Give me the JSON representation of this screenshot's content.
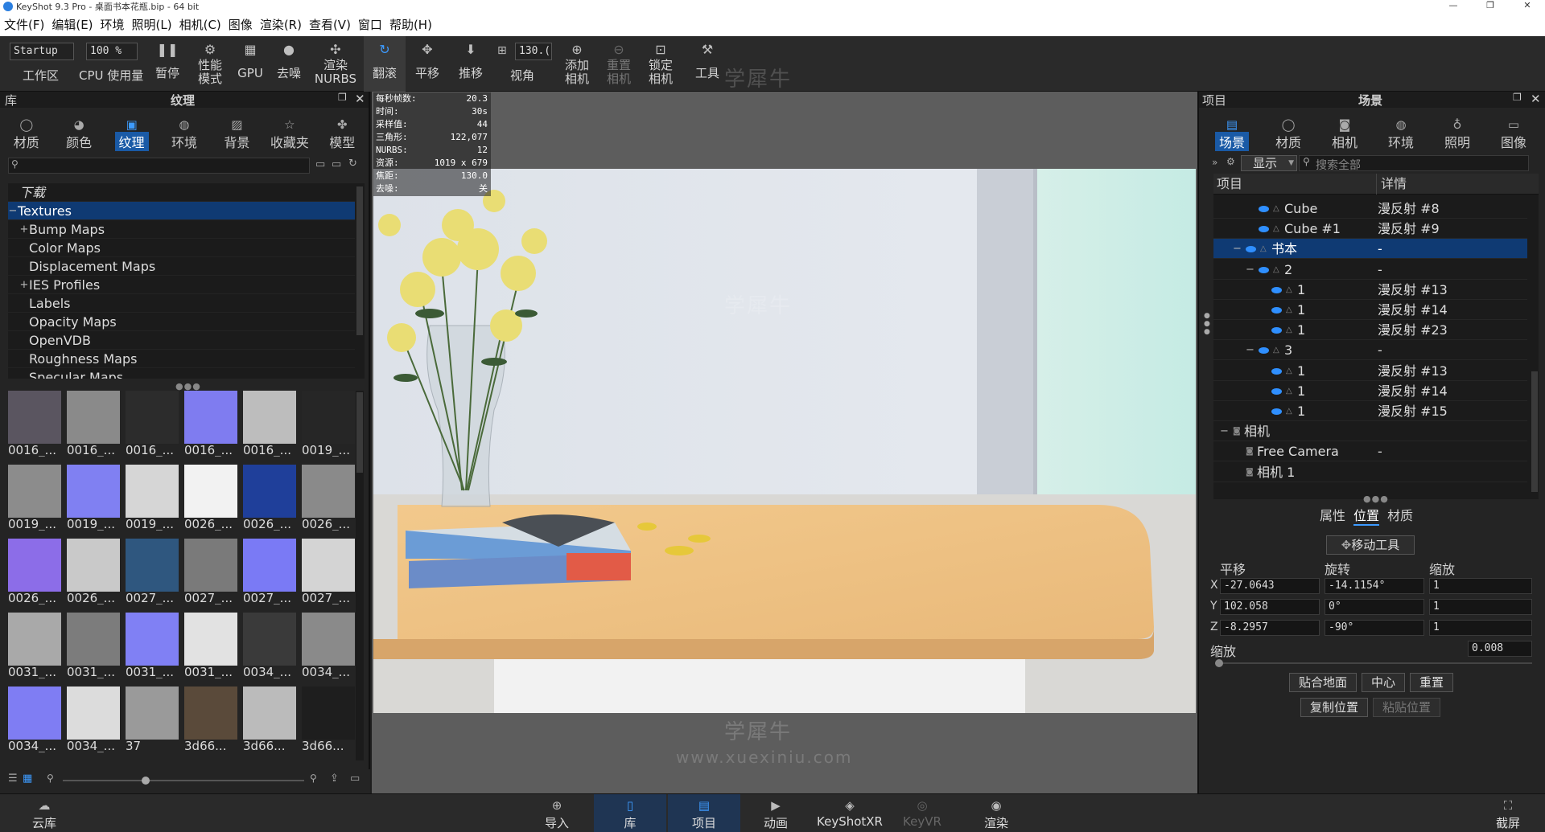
{
  "window": {
    "title": "KeyShot 9.3 Pro  - 桌面书本花瓶.bip  - 64 bit"
  },
  "menu": [
    "文件(F)",
    "编辑(E)",
    "环境",
    "照明(L)",
    "相机(C)",
    "图像",
    "渲染(R)",
    "查看(V)",
    "窗口",
    "帮助(H)"
  ],
  "toolbar": {
    "workspace_value": "Startup",
    "workspace_label": "工作区",
    "cpu_value": "100 %",
    "cpu_label": "CPU 使用量",
    "pause": "暂停",
    "perf1": "性能",
    "perf2": "模式",
    "gpu": "GPU",
    "denoise": "去噪",
    "nurbs1": "渲染",
    "nurbs2": "NURBS",
    "tumble": "翻滚",
    "pan": "平移",
    "dolly": "推移",
    "fov_value": "130.(",
    "fov_label": "视角",
    "addcam1": "添加",
    "addcam2": "相机",
    "resetcam1": "重置",
    "resetcam2": "相机",
    "lockcam1": "锁定",
    "lockcam2": "相机",
    "tools": "工具"
  },
  "library": {
    "header_left": "库",
    "header_title": "纹理",
    "tabs": [
      "材质",
      "颜色",
      "纹理",
      "环境",
      "背景",
      "收藏夹",
      "模型"
    ],
    "active_tab": 2,
    "tree": [
      {
        "label": "下载",
        "italic": true,
        "pm": ""
      },
      {
        "label": "Textures",
        "selected": true,
        "pm": "−"
      },
      {
        "label": "Bump Maps",
        "pm": "+"
      },
      {
        "label": "Color Maps",
        "pm": ""
      },
      {
        "label": "Displacement Maps",
        "pm": ""
      },
      {
        "label": "IES Profiles",
        "pm": "+"
      },
      {
        "label": "Labels",
        "pm": ""
      },
      {
        "label": "Opacity Maps",
        "pm": ""
      },
      {
        "label": "OpenVDB",
        "pm": ""
      },
      {
        "label": "Roughness Maps",
        "pm": ""
      },
      {
        "label": "Specular Maps",
        "pm": ""
      }
    ],
    "thumbs": [
      {
        "label": "0016_...",
        "color": "#5a5560"
      },
      {
        "label": "0016_...",
        "color": "#8a8a8a"
      },
      {
        "label": "0016_...",
        "color": "#2c2c2c"
      },
      {
        "label": "0016_...",
        "color": "#7f7cf0"
      },
      {
        "label": "0016_...",
        "color": "#bdbdbd"
      },
      {
        "label": "0019_...",
        "color": "#262626"
      },
      {
        "label": "0019_...",
        "color": "#8c8c8c"
      },
      {
        "label": "0019_...",
        "color": "#8080f2"
      },
      {
        "label": "0019_...",
        "color": "#d6d6d6"
      },
      {
        "label": "0026_...",
        "color": "#f2f2f2"
      },
      {
        "label": "0026_...",
        "color": "#1f3f9a"
      },
      {
        "label": "0026_...",
        "color": "#8a8a8a"
      },
      {
        "label": "0026_...",
        "color": "#8c6de8"
      },
      {
        "label": "0026_...",
        "color": "#c9c9c9"
      },
      {
        "label": "0027_...",
        "color": "#2f577f"
      },
      {
        "label": "0027_...",
        "color": "#7a7a7a"
      },
      {
        "label": "0027_...",
        "color": "#7a7af5"
      },
      {
        "label": "0027_...",
        "color": "#d4d4d4"
      },
      {
        "label": "0031_...",
        "color": "#a9a9a9"
      },
      {
        "label": "0031_...",
        "color": "#7c7c7c"
      },
      {
        "label": "0031_...",
        "color": "#8080f4"
      },
      {
        "label": "0031_...",
        "color": "#e2e2e2"
      },
      {
        "label": "0034_...",
        "color": "#3a3a3a"
      },
      {
        "label": "0034_...",
        "color": "#8a8a8a"
      },
      {
        "label": "0034_...",
        "color": "#7f7df3"
      },
      {
        "label": "0034_...",
        "color": "#dcdcdc"
      },
      {
        "label": "37",
        "color": "#9a9a9a"
      },
      {
        "label": "3d66...",
        "color": "#5a4a3a"
      },
      {
        "label": "3d66...",
        "color": "#bbbbbb"
      },
      {
        "label": "3d66...",
        "color": "#1e1e1e"
      }
    ],
    "footer_cloud": "云库"
  },
  "stats": [
    {
      "k": "每秒帧数:",
      "v": "20.3"
    },
    {
      "k": "时间:",
      "v": "30s"
    },
    {
      "k": "采样值:",
      "v": "44"
    },
    {
      "k": "三角形:",
      "v": "122,077"
    },
    {
      "k": "NURBS:",
      "v": "12"
    },
    {
      "k": "资源:",
      "v": "1019 x 679"
    },
    {
      "k": "焦距:",
      "v": "130.0"
    },
    {
      "k": "去噪:",
      "v": "关"
    }
  ],
  "scene_panel": {
    "header_left": "项目",
    "header_title": "场景",
    "tabs": [
      "场景",
      "材质",
      "相机",
      "环境",
      "照明",
      "图像"
    ],
    "show_label": "显示",
    "search_placeholder": "搜索全部",
    "col_item": "项目",
    "col_detail": "详情",
    "rows": [
      {
        "name": "Cube",
        "detail": "漫反射 #8",
        "indent": 56,
        "eye": true
      },
      {
        "name": "Cube #1",
        "detail": "漫反射 #9",
        "indent": 56,
        "eye": true
      },
      {
        "name": "书本",
        "detail": "-",
        "indent": 40,
        "eye": true,
        "sel": true,
        "pm": "−"
      },
      {
        "name": "2",
        "detail": "-",
        "indent": 56,
        "eye": true,
        "pm": "−"
      },
      {
        "name": "1",
        "detail": "漫反射 #13",
        "indent": 72,
        "eye": true
      },
      {
        "name": "1",
        "detail": "漫反射 #14",
        "indent": 72,
        "eye": true
      },
      {
        "name": "1",
        "detail": "漫反射 #23",
        "indent": 72,
        "eye": true
      },
      {
        "name": "3",
        "detail": "-",
        "indent": 56,
        "eye": true,
        "pm": "−"
      },
      {
        "name": "1",
        "detail": "漫反射 #13",
        "indent": 72,
        "eye": true
      },
      {
        "name": "1",
        "detail": "漫反射 #14",
        "indent": 72,
        "eye": true
      },
      {
        "name": "1",
        "detail": "漫反射 #15",
        "indent": 72,
        "eye": true
      },
      {
        "name": "相机",
        "detail": "",
        "indent": 24,
        "eye": false,
        "pm": "−"
      },
      {
        "name": "Free Camera",
        "detail": "-",
        "indent": 40,
        "eye": false
      },
      {
        "name": "相机 1",
        "detail": "",
        "indent": 40,
        "eye": false
      }
    ],
    "subtabs": [
      "属性",
      "位置",
      "材质"
    ],
    "move_tool": "移动工具",
    "translate": "平移",
    "rotate": "旋转",
    "scale": "缩放",
    "x_t": "-27.0643",
    "x_r": "-14.1154°",
    "x_s": "1",
    "y_t": "102.058",
    "y_r": "0°",
    "y_s": "1",
    "z_t": "-8.2957",
    "z_r": "-90°",
    "z_s": "1",
    "uniform_label": "缩放",
    "uniform_value": "0.008",
    "btn_ground": "贴合地面",
    "btn_center": "中心",
    "btn_reset": "重置",
    "btn_copy": "复制位置",
    "btn_paste": "粘贴位置"
  },
  "bottom": {
    "cloud": "云库",
    "import": "导入",
    "library": "库",
    "project": "项目",
    "animation": "动画",
    "keyshotxr": "KeyShotXR",
    "keyvr": "KeyVR",
    "render": "渲染",
    "screenshot": "截屏"
  },
  "watermarks": [
    "学犀牛",
    "www.xuexiniu.com"
  ]
}
